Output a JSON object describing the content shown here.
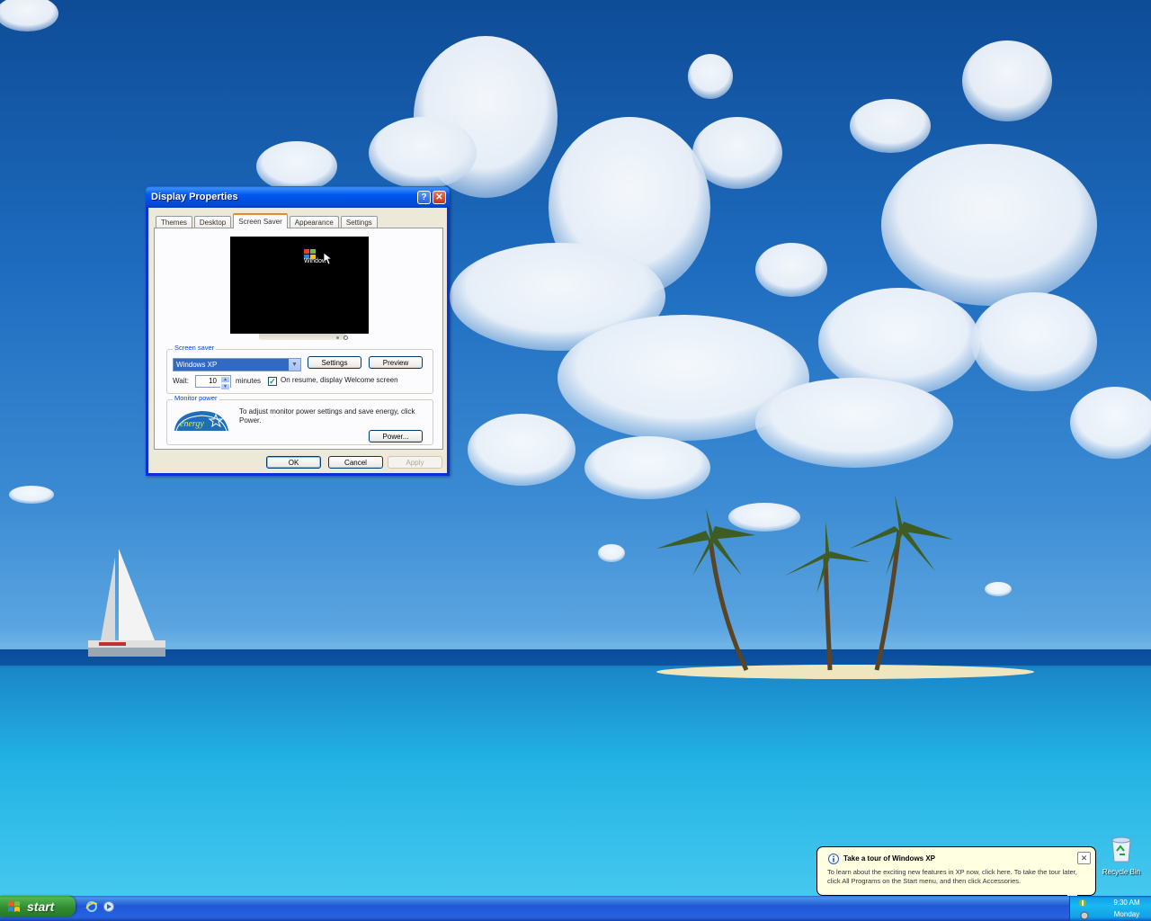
{
  "window": {
    "title": "Display Properties",
    "help_icon": "help-icon",
    "close_icon": "close-icon"
  },
  "tabs": [
    {
      "label": "Themes",
      "active": false
    },
    {
      "label": "Desktop",
      "active": false
    },
    {
      "label": "Screen Saver",
      "active": true
    },
    {
      "label": "Appearance",
      "active": false
    },
    {
      "label": "Settings",
      "active": false
    }
  ],
  "preview": {
    "logo_text": "Window"
  },
  "screensaver": {
    "group_label": "Screen saver",
    "selected": "Windows XP",
    "settings_label": "Settings",
    "preview_label": "Preview",
    "wait_label": "Wait:",
    "wait_value": "10",
    "minutes_label": "minutes",
    "resume_label": "On resume, display Welcome screen",
    "resume_checked": true
  },
  "monitor_power": {
    "group_label": "Monitor power",
    "text": "To adjust monitor power settings and save energy, click Power.",
    "power_label": "Power..."
  },
  "dialog_buttons": {
    "ok": "OK",
    "cancel": "Cancel",
    "apply": "Apply"
  },
  "desktop": {
    "recycle_bin": "Recycle Bin"
  },
  "balloon": {
    "title": "Take a tour of Windows XP",
    "body": "To learn about the exciting new features in XP now, click here. To take the tour later, click All Programs on the Start menu, and then click Accessories.",
    "icon": "info-icon"
  },
  "taskbar": {
    "start_label": "start",
    "clock_time": "9:30 AM",
    "clock_day": "Monday"
  },
  "colors": {
    "titlebar": "#0058ee",
    "start_green": "#2f8a2f",
    "tray_blue": "#14a0e6",
    "balloon_bg": "#ffffe1"
  }
}
